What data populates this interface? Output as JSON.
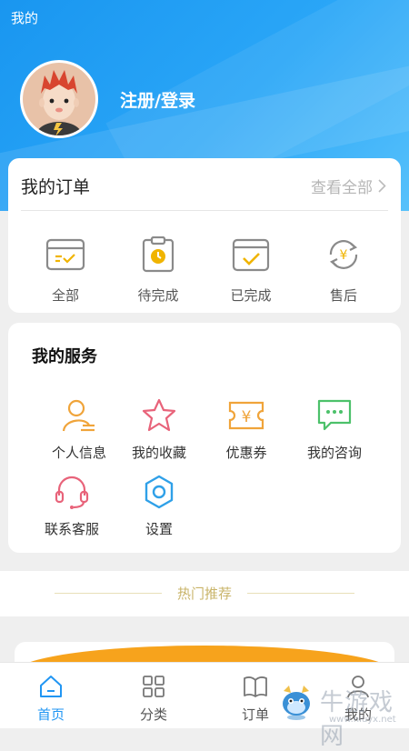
{
  "status_bar": {
    "title": "我的"
  },
  "profile": {
    "login_label": "注册/登录"
  },
  "orders": {
    "title": "我的订单",
    "view_all": "查看全部",
    "items": [
      {
        "label": "全部",
        "icon": "box-check-icon"
      },
      {
        "label": "待完成",
        "icon": "clipboard-pending-icon"
      },
      {
        "label": "已完成",
        "icon": "calendar-check-icon"
      },
      {
        "label": "售后",
        "icon": "yuan-refund-icon"
      }
    ]
  },
  "services": {
    "title": "我的服务",
    "items": [
      {
        "label": "个人信息",
        "icon": "person-icon",
        "color": "#f0a43a"
      },
      {
        "label": "我的收藏",
        "icon": "star-icon",
        "color": "#e8637a"
      },
      {
        "label": "优惠券",
        "icon": "coupon-icon",
        "color": "#f0a43a"
      },
      {
        "label": "我的咨询",
        "icon": "chat-icon",
        "color": "#4cc16a"
      },
      {
        "label": "联系客服",
        "icon": "headset-icon",
        "color": "#e8637a"
      },
      {
        "label": "设置",
        "icon": "gear-icon",
        "color": "#2fa0e8"
      }
    ]
  },
  "hot": {
    "title": "热门推荐"
  },
  "tabbar": {
    "items": [
      {
        "label": "首页",
        "icon": "home-icon",
        "active": true
      },
      {
        "label": "分类",
        "icon": "grid-icon",
        "active": false
      },
      {
        "label": "订单",
        "icon": "book-icon",
        "active": false
      },
      {
        "label": "我的",
        "icon": "user-icon",
        "active": false
      }
    ]
  },
  "watermark": {
    "name": "牛游戏网",
    "url": "www.niuyx.net"
  },
  "colors": {
    "primary": "#2196f3",
    "hot_text": "#c9b469"
  }
}
